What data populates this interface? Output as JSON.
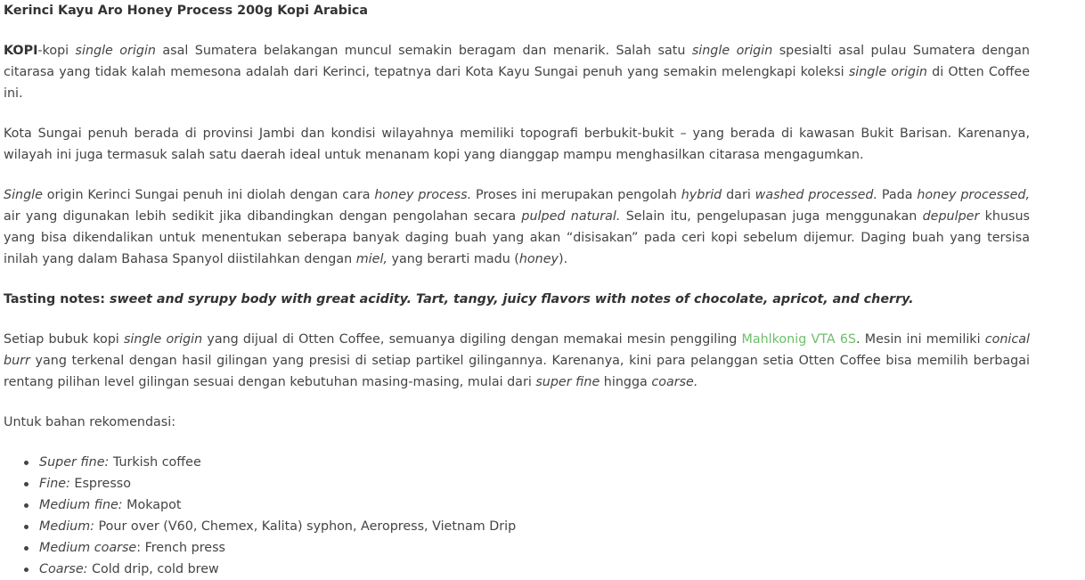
{
  "title": "Kerinci Kayu Aro Honey Process 200g Kopi Arabica",
  "p1": {
    "kw": "KOPI",
    "t1": "-kopi ",
    "e1": "single origin",
    "t2": " asal Sumatera belakangan muncul semakin beragam dan menarik. Salah satu ",
    "e2": "single origin",
    "t3": " spesialti asal pulau Sumatera dengan citarasa yang tidak kalah memesona adalah dari Kerinci, tepatnya dari Kota Kayu Sungai penuh yang semakin melengkapi koleksi ",
    "e3": "single origin",
    "t4": " di Otten Coffee ini."
  },
  "p2": {
    "t1": "Kota Sungai penuh berada di provinsi Jambi dan kondisi wilayahnya memiliki topografi berbukit-bukit – yang berada di kawasan Bukit Barisan. Karenanya, wilayah ini juga termasuk salah satu daerah ideal untuk menanam kopi yang dianggap mampu menghasilkan citarasa mengagumkan."
  },
  "p3": {
    "e1": "Single",
    "t1": " origin Kerinci Sungai penuh ini diolah dengan cara ",
    "e2": "honey process.",
    "t2": " Proses ini merupakan pengolah ",
    "e3": "hybrid",
    "t3": " dari ",
    "e4": "washed processed.",
    "t4": " Pada ",
    "e5": "honey processed,",
    "t5": " air yang digunakan lebih sedikit jika dibandingkan dengan pengolahan secara ",
    "e6": "pulped natural.",
    "t6": " Selain itu, pengelupasan juga menggunakan ",
    "e7": "depulper",
    "t7": " khusus yang bisa dikendalikan untuk menentukan seberapa banyak daging buah yang akan “disisakan” pada ceri kopi sebelum dijemur. Daging buah yang tersisa inilah yang dalam Bahasa Spanyol diistilahkan dengan ",
    "e8": "miel,",
    "t8": " yang berarti madu (",
    "e9": "honey",
    "t9": ")."
  },
  "tasting": {
    "label": "Tasting notes: ",
    "notes": "sweet and syrupy body with great acidity. Tart, tangy, juicy flavors with notes of chocolate, apricot, and cherry."
  },
  "p4": {
    "t1": "Setiap bubuk kopi ",
    "e1": "single origin",
    "t2": " yang dijual di Otten Coffee, semuanya digiling dengan memakai mesin penggiling ",
    "link": "Mahlkonig VTA 6S",
    "t3": ". Mesin ini memiliki ",
    "e2": "conical burr",
    "t4": " yang terkenal dengan hasil gilingan yang presisi di setiap partikel gilingannya. Karenanya, kini para pelanggan setia Otten Coffee bisa memilih berbagai rentang pilihan level gilingan sesuai dengan kebutuhan masing-masing, mulai dari ",
    "e3": "super fine",
    "t5": " hingga ",
    "e4": "coarse."
  },
  "p5": {
    "t1": "Untuk bahan rekomendasi:"
  },
  "grind_list": [
    {
      "level": "Super fine:",
      "use": " Turkish coffee"
    },
    {
      "level": "Fine:",
      "use": " Espresso"
    },
    {
      "level": "Medium fine:",
      "use": " Mokapot"
    },
    {
      "level": "Medium:",
      "use": " Pour over (V60, Chemex, Kalita) syphon, Aeropress, Vietnam Drip"
    },
    {
      "level": "Medium coarse",
      "use": ": French press"
    },
    {
      "level": "Coarse:",
      "use": " Cold drip, cold brew"
    }
  ],
  "colors": {
    "text": "#444444",
    "link": "#6dbf6b"
  }
}
